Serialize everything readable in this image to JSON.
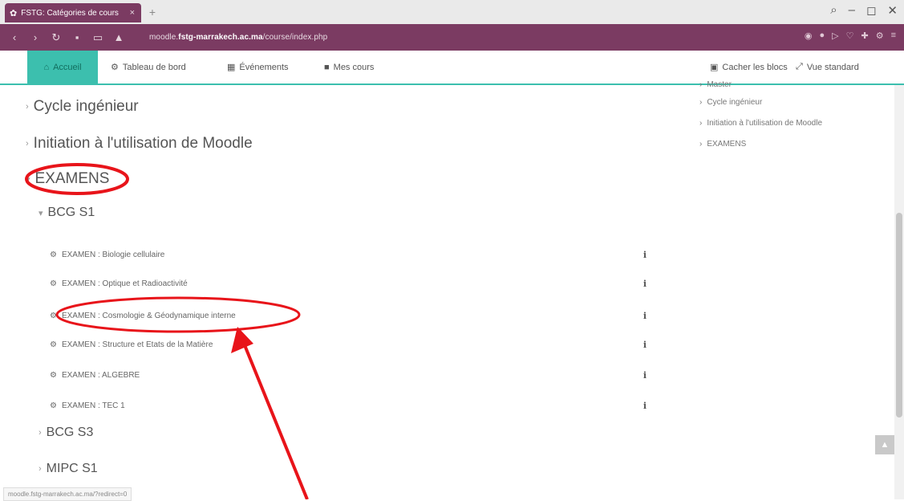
{
  "browser": {
    "tab_title": "FSTG: Catégories de cours",
    "tab_close": "×",
    "new_tab": "+",
    "win_controls": [
      "search",
      "minimize",
      "restore",
      "close"
    ],
    "url_prefix": "moodle.",
    "url_domain": "fstg-marrakech.ac.ma",
    "url_path": "/course/index.php",
    "status_url": "moodle.fstg-marrakech.ac.ma/?redirect=0"
  },
  "nav": {
    "home": "Accueil",
    "dashboard": "Tableau de bord",
    "events": "Événements",
    "mycourses": "Mes cours",
    "hide_blocks": "Cacher les blocs",
    "standard_view": "Vue standard"
  },
  "categories": [
    {
      "label": "Cycle ingénieur",
      "state": "collapsed"
    },
    {
      "label": "Initiation à l'utilisation de Moodle",
      "state": "collapsed"
    },
    {
      "label": "EXAMENS",
      "state": "expanded"
    }
  ],
  "subcategories": [
    {
      "label": "BCG S1",
      "state": "expanded"
    },
    {
      "label": "BCG S3",
      "state": "collapsed"
    },
    {
      "label": "MIPC S1",
      "state": "collapsed"
    }
  ],
  "courses": [
    {
      "label": "EXAMEN : Biologie cellulaire"
    },
    {
      "label": "EXAMEN : Optique et Radioactivité"
    },
    {
      "label": "EXAMEN : Cosmologie & Géodynamique interne"
    },
    {
      "label": "EXAMEN : Structure et Etats de la Matière"
    },
    {
      "label": "EXAMEN : ALGEBRE"
    },
    {
      "label": "EXAMEN : TEC 1"
    }
  ],
  "right_block": [
    "Master",
    "Cycle ingénieur",
    "Initiation à l'utilisation de Moodle",
    "EXAMENS"
  ],
  "colors": {
    "brand": "#7b3b62",
    "accent": "#3cbfae",
    "annotation": "#e8141a"
  }
}
